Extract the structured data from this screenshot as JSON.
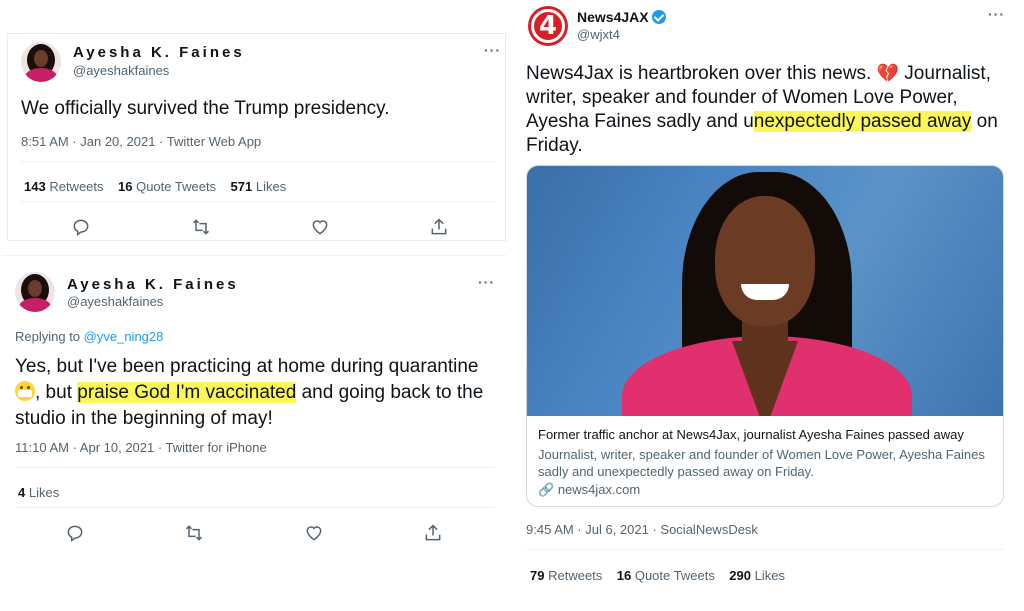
{
  "tweets": [
    {
      "display_name": "Ayesha K. Faines",
      "handle": "@ayeshakfaines",
      "text": "We officially survived the Trump presidency.",
      "meta": "8:51 AM · Jan 20, 2021 · Twitter Web App",
      "stats": [
        {
          "count": "143",
          "label": "Retweets"
        },
        {
          "count": "16",
          "label": "Quote Tweets"
        },
        {
          "count": "571",
          "label": "Likes"
        }
      ],
      "more_icon": "more-horizontal-icon"
    },
    {
      "display_name": "Ayesha K. Faines",
      "handle": "@ayeshakfaines",
      "replying_to_prefix": "Replying to",
      "replying_to": "@yve_ning28",
      "text_before": "Yes, but I've been practicing at home during quarantine",
      "text_mid": ", but ",
      "text_highlight": "praise God I'm vaccinated",
      "text_after": " and going back to the studio in the beginning of may!",
      "emoji": "grimacing-face",
      "meta": "11:10 AM · Apr 10, 2021 · Twitter for iPhone",
      "stats": [
        {
          "count": "4",
          "label": "Likes"
        }
      ]
    },
    {
      "display_name": "News4JAX",
      "verified": true,
      "handle": "@wjxt4",
      "logo_text": "4",
      "text_before": "News4Jax is heartbroken over this news.",
      "text_mid": " Journalist, writer, speaker and founder of Women Love Power, Ayesha Faines sadly and u",
      "text_highlight": "nexpectedly passed away",
      "text_after": " on Friday.",
      "emoji": "broken-heart",
      "link_card": {
        "title": "Former traffic anchor at News4Jax, journalist Ayesha Faines passed away",
        "description": "Journalist, writer, speaker and founder of Women Love Power, Ayesha Faines sadly and unexpectedly passed away on Friday.",
        "domain": "news4jax.com"
      },
      "meta": "9:45 AM · Jul 6, 2021 · SocialNewsDesk",
      "stats": [
        {
          "count": "79",
          "label": "Retweets"
        },
        {
          "count": "16",
          "label": "Quote Tweets"
        },
        {
          "count": "290",
          "label": "Likes"
        }
      ]
    }
  ],
  "more_label": "···",
  "colors": {
    "highlight": "#fbf65a",
    "link": "#1d9bf0",
    "secondary": "#536471",
    "news_red": "#d62027"
  }
}
